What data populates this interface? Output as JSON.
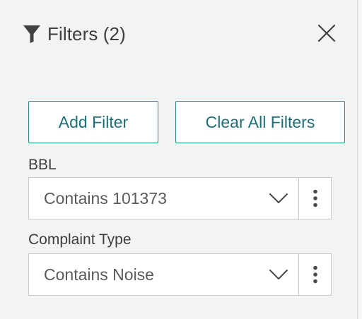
{
  "panel": {
    "title": "Filters (2)",
    "icons": {
      "filter": "filter-funnel-icon",
      "close": "close-x-icon"
    }
  },
  "actions": {
    "add_filter_label": "Add Filter",
    "clear_all_label": "Clear All Filters"
  },
  "filters": [
    {
      "label": "BBL",
      "value": "Contains 101373",
      "icons": {
        "dropdown": "chevron-down-icon",
        "menu": "more-vertical-icon"
      }
    },
    {
      "label": "Complaint Type",
      "value": "Contains Noise",
      "icons": {
        "dropdown": "chevron-down-icon",
        "menu": "more-vertical-icon"
      }
    }
  ],
  "colors": {
    "background": "#f3f3f3",
    "accent": "#2a8c8c",
    "accent_text": "#1e6f78",
    "text": "#3d3d3d",
    "field_border": "#c9c9c9"
  }
}
